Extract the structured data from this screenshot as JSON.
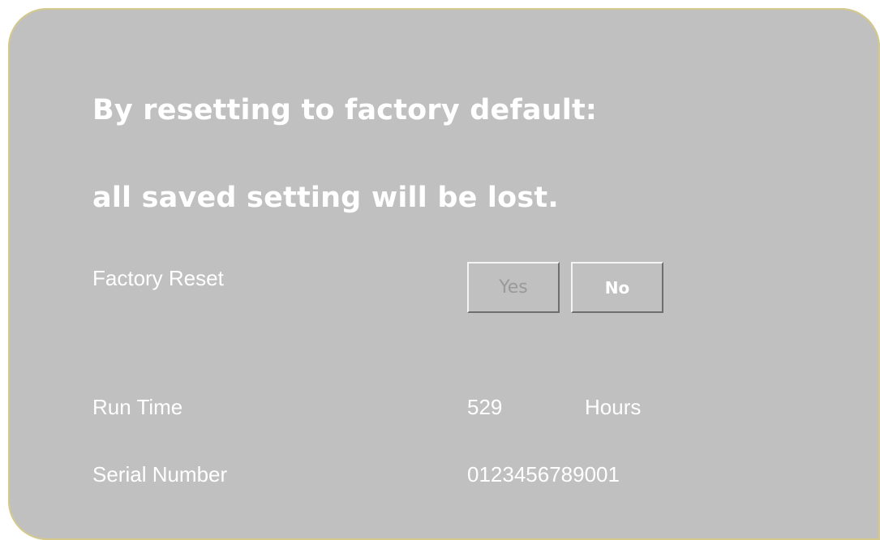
{
  "dialog": {
    "heading_line1": "By resetting to factory default:",
    "heading_line2": "all saved setting will be lost."
  },
  "factory_reset": {
    "label": "Factory Reset",
    "yes_label": "Yes",
    "no_label": "No"
  },
  "run_time": {
    "label": "Run Time",
    "value": "529",
    "unit": "Hours"
  },
  "serial_number": {
    "label": "Serial Number",
    "value": "0123456789001"
  },
  "colors": {
    "panel_background": "#c0c0c0",
    "text": "#ffffff",
    "disabled_text": "#9a9a9a"
  }
}
